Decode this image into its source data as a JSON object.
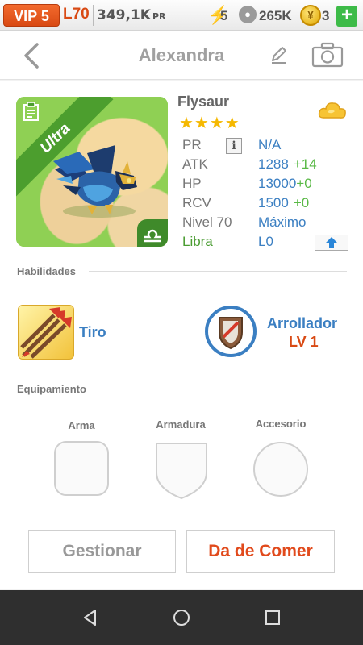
{
  "status": {
    "vip": "VIP 5",
    "level": "L70",
    "power_value": "349,1K",
    "power_unit": "PR",
    "energy": "5",
    "food": "265K",
    "gems": "3",
    "add_label": "+"
  },
  "header": {
    "title": "Alexandra"
  },
  "pet": {
    "ribbon": "Ultra",
    "name": "Flysaur",
    "stars": "★★★★",
    "star_count": 4,
    "stats": {
      "pr_label": "PR",
      "pr_info": "i",
      "pr_value": "N/A",
      "atk_label": "ATK",
      "atk_value": "1288",
      "atk_bonus": "+14",
      "hp_label": "HP",
      "hp_value": "13000",
      "hp_bonus": "+0",
      "rcv_label": "RCV",
      "rcv_value": "1500",
      "rcv_bonus": "+0",
      "level_label": "Nivel 70",
      "level_value": "Máximo",
      "sign_label": "Libra",
      "sign_value": "L0"
    }
  },
  "skills": {
    "section_label": "Habilidades",
    "skill1_name": "Tiro",
    "skill2_name": "Arrollador",
    "skill2_level": "LV 1"
  },
  "equipment": {
    "section_label": "Equipamiento",
    "weapon_label": "Arma",
    "armor_label": "Armadura",
    "accessory_label": "Accesorio"
  },
  "actions": {
    "manage_label": "Gestionar",
    "feed_label": "Da de Comer"
  },
  "colors": {
    "accent_orange": "#d94a14",
    "link_blue": "#3b7fc2",
    "bonus_green": "#5ab947",
    "star_gold": "#f5b800"
  }
}
